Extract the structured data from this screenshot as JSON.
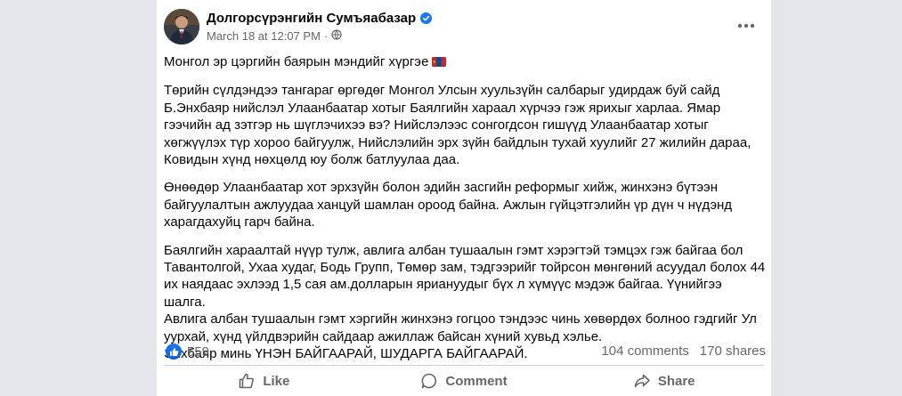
{
  "post": {
    "author": "Долгорсүрэнгийн Сумъяабазар",
    "timestamp": "March 18 at 12:07 PM",
    "separator": "·",
    "privacy_icon": "globe-icon",
    "menu_icon": "more-dots-icon",
    "paragraphs": [
      "Монгол эр цэргийн баярын мэндийг хүргэе",
      "Төрийн сүлдэндээ тангараг өргөдөг Монгол Улсын хуульзүйн салбарыг удирдаж буй сайд Б.Энхбаяр нийслэл Улаанбаатар хотыг Баялгийн хараал хүрчээ гэж ярихыг харлаа. Ямар гээчийн ад зэтгэр нь шүглэчихээ вэ? Нийслэлээс сонгогдсон гишүүд Улаанбаатар хотыг хөгжүүлэх түр хороо байгуулж, Нийслэлийн эрх зүйн байдлын тухай хуулийг 27 жилийн дараа, Ковидын хүнд нөхцөлд юу болж батлуулаа даа.",
      "Өнөөдөр Улаанбаатар хот эрхзүйн болон эдийн засгийн реформыг хийж, жинхэнэ бүтээн байгуулалтын ажлуудаа ханцуй шамлан ороод байна. Ажлын гүйцэтгэлийн үр дүн ч нүдэнд харагдахуйц гарч байна.",
      "Баялгийн хараалтай нүүр тулж, авлига албан тушаалын гэмт хэрэгтэй тэмцэх гэж байгаа бол Тавантолгой, Ухаа худаг, Бодь Групп, Төмөр зам, тэдгээрийг тойрсон мөнгөний асуудал болох 44 их наядаас эхлээд 1,5 сая ам.долларын яриануудыг бүх л хүмүүс мэдэж байгаа. Үүнийгээ шалга.",
      "Авлига албан тушаалын гэмт хэргийн жинхэнэ гогцоо тэндээс чинь хөвөрдөх болноо гэдгийг Ул уурхай, хүнд үйлдвэрийн сайдаар ажиллаж байсан хүний хувьд хэлье.",
      "Энхбаяр минь ҮНЭН БАЙГААРАЙ, ШУДАРГА БАЙГААРАЙ."
    ],
    "flag_icon": "mongolia-flag-icon"
  },
  "stats": {
    "reaction_icon": "like-reaction-icon",
    "reactions": "559",
    "comments": "104 comments",
    "shares": "170 shares"
  },
  "actions": {
    "like": "Like",
    "comment": "Comment",
    "share": "Share"
  },
  "colors": {
    "brand_blue": "#1877f2",
    "secondary_text": "#65676b",
    "page_bg": "#e4e6e9"
  }
}
